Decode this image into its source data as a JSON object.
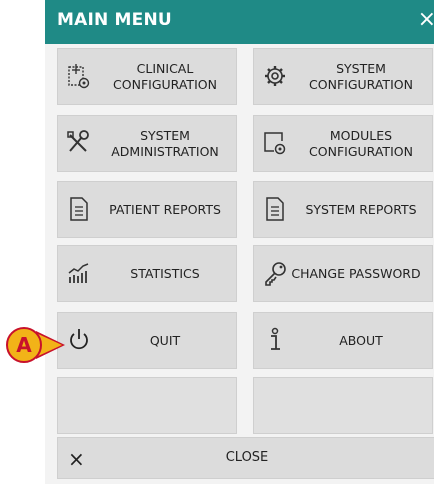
{
  "header": {
    "title": "MAIN MENU",
    "close_glyph": "×"
  },
  "tiles": {
    "clinical_config": {
      "line1": "CLINICAL",
      "line2": "CONFIGURATION",
      "icon": "clinical-config-icon"
    },
    "system_config": {
      "line1": "SYSTEM",
      "line2": "CONFIGURATION",
      "icon": "gear-icon"
    },
    "system_admin": {
      "line1": "SYSTEM",
      "line2": "ADMINISTRATION",
      "icon": "tools-icon"
    },
    "modules_config": {
      "line1": "MODULES",
      "line2": "CONFIGURATION",
      "icon": "modules-config-icon"
    },
    "patient_reports": {
      "label": "PATIENT REPORTS",
      "icon": "report-icon"
    },
    "system_reports": {
      "label": "SYSTEM REPORTS",
      "icon": "report-icon"
    },
    "statistics": {
      "label": "STATISTICS",
      "icon": "chart-icon"
    },
    "change_password": {
      "label": "CHANGE PASSWORD",
      "icon": "key-icon"
    },
    "quit": {
      "label": "QUIT",
      "icon": "power-icon"
    },
    "about": {
      "label": "ABOUT",
      "icon": "info-icon"
    }
  },
  "close_bar": {
    "label": "CLOSE",
    "glyph": "×"
  },
  "callout": {
    "label": "A"
  },
  "colors": {
    "header": "#1f8a86",
    "tile": "#dcdcdc",
    "callout_fill": "#f2b318",
    "callout_border": "#c8112b"
  }
}
